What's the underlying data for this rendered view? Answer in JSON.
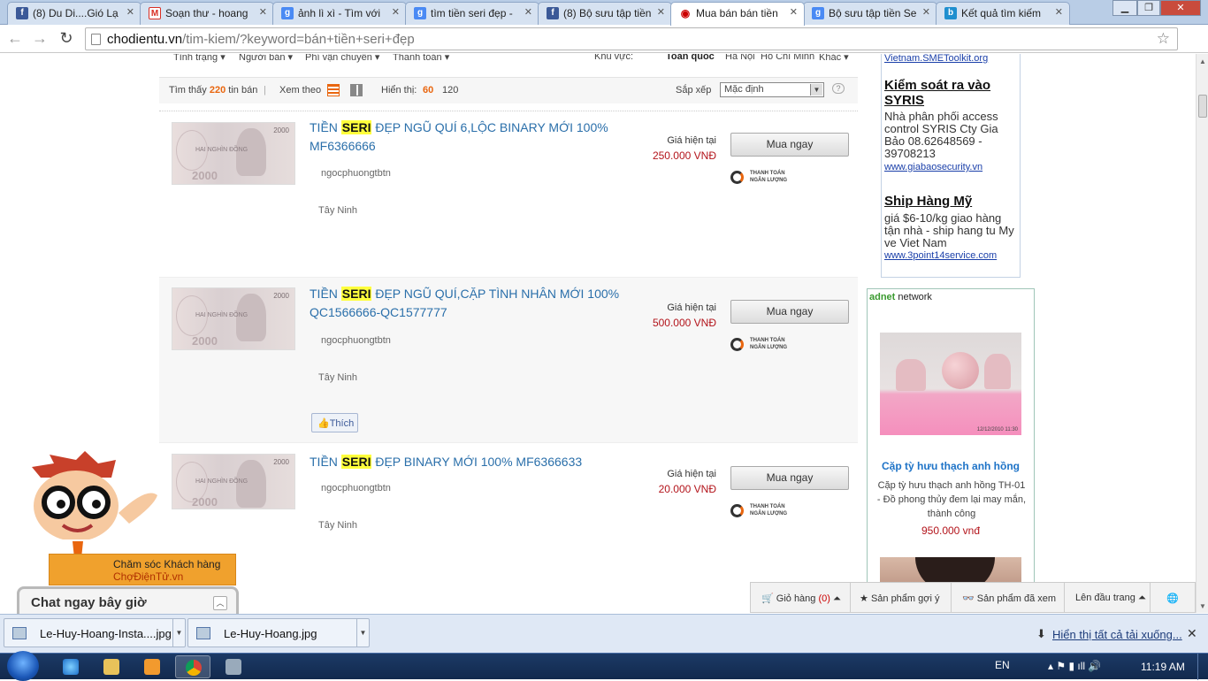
{
  "browser": {
    "tabs": [
      {
        "title": "(8) Du Di....Gió Lạ",
        "favicon": "facebook-icon"
      },
      {
        "title": "Soạn thư - hoang",
        "favicon": "gmail-icon"
      },
      {
        "title": "ảnh lì xì - Tìm với",
        "favicon": "google-icon"
      },
      {
        "title": "tìm tiền seri đẹp -",
        "favicon": "google-icon"
      },
      {
        "title": "(8) Bộ sưu tập tiền",
        "favicon": "facebook-icon"
      },
      {
        "title": "Mua bán bán tiền",
        "favicon": "chodientu-icon",
        "active": true
      },
      {
        "title": "Bộ sưu tập tiền Se",
        "favicon": "google-icon"
      },
      {
        "title": "Kết quả tìm kiếm",
        "favicon": "bing-icon"
      }
    ],
    "url_host": "chodientu.vn",
    "url_path": "/tim-kiem/?keyword=bán+tiền+seri+đẹp"
  },
  "filters": {
    "condition": "Tình trạng",
    "seller": "Người bán",
    "shipping": "Phí vận chuyển",
    "payment": "Thanh toán",
    "region_label": "Khu vực:",
    "regions": [
      "Toàn quốc",
      "Hà Nội",
      "Hồ Chí Minh",
      "Khác"
    ]
  },
  "results": {
    "found_prefix": "Tìm thấy",
    "found_count": "220",
    "found_suffix": "tin bán",
    "view_label": "Xem theo",
    "show_label": "Hiển thị:",
    "show_options": [
      "60",
      "120"
    ],
    "sort_label": "Sắp xếp",
    "sort_value": "Mặc định",
    "help": "?"
  },
  "products": [
    {
      "title_prefix": "TIỀN ",
      "highlight": "SERI",
      "title_rest": " ĐẸP NGŨ QUÍ 6,LỘC BINARY MỚI 100% MF6366666",
      "seller": "ngocphuongtbtn",
      "location": "Tây Ninh",
      "price_label": "Giá hiện tại",
      "price": "250.000 VNĐ",
      "buy": "Mua ngay",
      "pay": "THANH TOÁN NGÂN LƯỢNG"
    },
    {
      "title_prefix": "TIỀN ",
      "highlight": "SERI",
      "title_rest": " ĐẸP NGŨ QUÍ,CẶP TÌNH NHÂN MỚI 100% QC1566666-QC1577777",
      "seller": "ngocphuongtbtn",
      "location": "Tây Ninh",
      "price_label": "Giá hiện tại",
      "price": "500.000 VNĐ",
      "buy": "Mua ngay",
      "pay": "THANH TOÁN NGÂN LƯỢNG",
      "like": "Thích"
    },
    {
      "title_prefix": "TIỀN ",
      "highlight": "SERI",
      "title_rest": " ĐẸP BINARY MỚI 100% MF6366633",
      "seller": "ngocphuongtbtn",
      "location": "Tây Ninh",
      "price_label": "Giá hiện tại",
      "price": "20.000 VNĐ",
      "buy": "Mua ngay",
      "pay": "THANH TOÁN NGÂN LƯỢNG"
    }
  ],
  "banknote": {
    "value": "2000",
    "text": "HAI NGHÌN ĐỒNG"
  },
  "text_ads": [
    {
      "url": "Vietnam.SMEToolkit.org"
    },
    {
      "title": "Kiểm soát ra vào SYRIS",
      "desc": "Nhà phân phối access control SYRIS Cty Gia Bảo 08.62648569 - 39708213",
      "url": "www.giabaosecurity.vn"
    },
    {
      "title": "Ship Hàng Mỹ",
      "desc": "giá $6-10/kg giao hàng tận nhà - ship hang tu My ve Viet Nam",
      "url": "www.3point14service.com"
    }
  ],
  "adnet": {
    "logo_brand": "adnet",
    "logo_suffix": " network",
    "title": "Cặp tỳ hưu thạch anh hồng",
    "desc": "Cặp tỳ hưu thạch anh hồng TH-01 - Đồ phong thủy đem lại may mắn, thành công",
    "price": "950.000 vnđ",
    "photo_date": "12/12/2010 11:30"
  },
  "support": {
    "line1": "Chăm sóc Khách hàng",
    "line2": "ChợĐiệnTử.vn"
  },
  "chat": {
    "title": "Chat ngay bây giờ"
  },
  "bottom_tools": {
    "cart": "Giỏ hàng",
    "cart_count": "(0)",
    "suggest": "Sản phẩm gợi ý",
    "viewed": "Sản phẩm đã xem",
    "top": "Lên đầu trang"
  },
  "downloads": {
    "items": [
      "Le-Huy-Hoang-Insta....jpg",
      "Le-Huy-Hoang.jpg"
    ],
    "show_all": "Hiển thị tất cả tải xuống..."
  },
  "taskbar": {
    "lang": "EN",
    "time": "11:19 AM"
  },
  "colors": {
    "link": "#2a6faa",
    "price": "#b3141b",
    "accent": "#e9660f",
    "highlight": "#ffff3c"
  }
}
